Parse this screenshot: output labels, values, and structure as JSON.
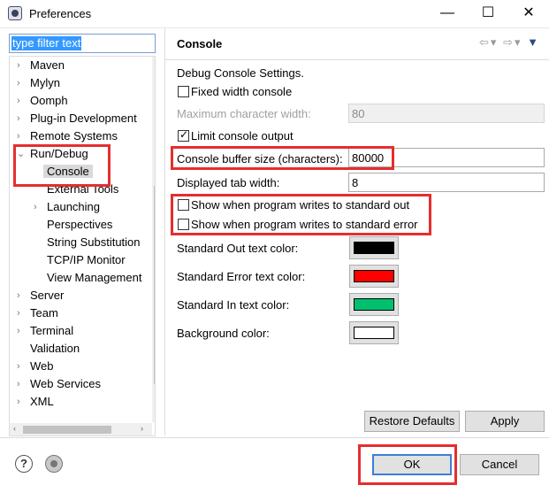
{
  "window": {
    "title": "Preferences",
    "minimize": "—",
    "maximize": "☐",
    "close": "✕"
  },
  "filter": {
    "value": "type filter text"
  },
  "tree": {
    "items": [
      {
        "label": "Maven",
        "expander": "›"
      },
      {
        "label": "Mylyn",
        "expander": "›"
      },
      {
        "label": "Oomph",
        "expander": "›"
      },
      {
        "label": "Plug-in Development",
        "expander": "›"
      },
      {
        "label": "Remote Systems",
        "expander": "›"
      },
      {
        "label": "Run/Debug",
        "expander": "⌄"
      },
      {
        "label": "Console",
        "expander": ""
      },
      {
        "label": "External Tools",
        "expander": ""
      },
      {
        "label": "Launching",
        "expander": "›"
      },
      {
        "label": "Perspectives",
        "expander": ""
      },
      {
        "label": "String Substitution",
        "expander": ""
      },
      {
        "label": "TCP/IP Monitor",
        "expander": ""
      },
      {
        "label": "View Management",
        "expander": ""
      },
      {
        "label": "Server",
        "expander": "›"
      },
      {
        "label": "Team",
        "expander": "›"
      },
      {
        "label": "Terminal",
        "expander": "›"
      },
      {
        "label": "Validation",
        "expander": ""
      },
      {
        "label": "Web",
        "expander": "›"
      },
      {
        "label": "Web Services",
        "expander": "›"
      },
      {
        "label": "XML",
        "expander": "›"
      }
    ],
    "scroll_left": "‹",
    "scroll_right": "›"
  },
  "page": {
    "title": "Console",
    "back_icon": "⇦",
    "forward_icon": "⇨",
    "dropdown_icon": "▾",
    "menu_icon": "▼",
    "description": "Debug Console Settings.",
    "fixed_width": {
      "label": "Fixed width console",
      "checked": false
    },
    "max_char_width": {
      "label": "Maximum character width:",
      "value": "80"
    },
    "limit_output": {
      "label": "Limit console output",
      "checked": true
    },
    "buffer_size": {
      "label": "Console buffer size (characters):",
      "value": "80000"
    },
    "tab_width": {
      "label": "Displayed tab width:",
      "value": "8"
    },
    "show_out": {
      "label": "Show when program writes to standard out",
      "checked": false
    },
    "show_err": {
      "label": "Show when program writes to standard error",
      "checked": false
    },
    "colors": [
      {
        "label": "Standard Out text color:",
        "color": "#000000"
      },
      {
        "label": "Standard Error text color:",
        "color": "#ff0000"
      },
      {
        "label": "Standard In text color:",
        "color": "#00c070"
      },
      {
        "label": "Background color:",
        "color": "#ffffff"
      }
    ],
    "restore_defaults": "Restore Defaults",
    "apply": "Apply"
  },
  "footer": {
    "help": "?",
    "ok": "OK",
    "cancel": "Cancel"
  },
  "theme": {
    "highlight": "#e52e2e",
    "focus": "#3c7fd6"
  }
}
